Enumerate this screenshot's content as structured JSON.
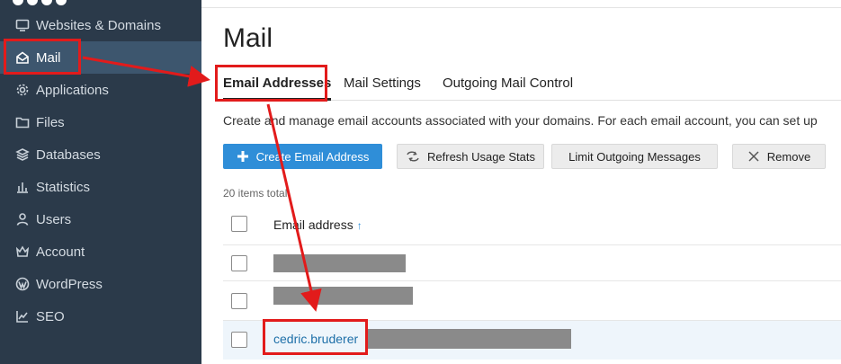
{
  "sidebar": {
    "items": [
      {
        "label": "Websites & Domains",
        "icon": "monitor-icon"
      },
      {
        "label": "Mail",
        "icon": "mail-open-icon",
        "active": true
      },
      {
        "label": "Applications",
        "icon": "gear-icon"
      },
      {
        "label": "Files",
        "icon": "folder-icon"
      },
      {
        "label": "Databases",
        "icon": "database-icon"
      },
      {
        "label": "Statistics",
        "icon": "bar-chart-icon"
      },
      {
        "label": "Users",
        "icon": "user-icon"
      },
      {
        "label": "Account",
        "icon": "crown-icon"
      },
      {
        "label": "WordPress",
        "icon": "wordpress-icon"
      },
      {
        "label": "SEO",
        "icon": "chart-line-icon"
      }
    ]
  },
  "main": {
    "title": "Mail",
    "tabs": [
      {
        "label": "Email Addresses",
        "active": true
      },
      {
        "label": "Mail Settings"
      },
      {
        "label": "Outgoing Mail Control"
      }
    ],
    "description": "Create and manage email accounts associated with your domains. For each email account, you can set up",
    "toolbar": {
      "create_label": "Create Email Address",
      "refresh_label": "Refresh Usage Stats",
      "limit_label": "Limit Outgoing Messages",
      "remove_label": "Remove"
    },
    "items_count": "20 items total",
    "table": {
      "column_header": "Email address",
      "sort_indicator": "↑",
      "rows": [
        {
          "email": "",
          "redacted": true
        },
        {
          "email": "",
          "redacted": true
        },
        {
          "email": "cedric.bruderer",
          "redacted_suffix": true,
          "highlighted": true
        }
      ]
    }
  },
  "colors": {
    "sidebar_bg": "#2b3a4a",
    "sidebar_active": "#3d566e",
    "primary_button": "#2f8ed8",
    "link": "#1d6fa8",
    "annotation": "#e21b1b"
  }
}
